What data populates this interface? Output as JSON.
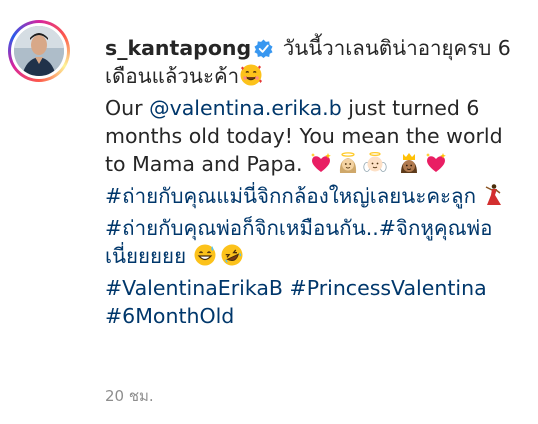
{
  "post": {
    "username": "s_kantapong",
    "caption_thai": "วันนี้วาเลนติน่าอายุครบ 6 เดือนแล้วนะค้า",
    "caption_en_before": "Our ",
    "mention": "@valentina.erika.b",
    "caption_en_after": " just turned 6 months old today! You mean the world to Mama and Papa.",
    "hashtag_1": "#ถ่ายกับคุณแม่นี่จิกกล้องใหญ่เลยนะคะลูก",
    "hashtag_2": "#ถ่ายกับคุณพ่อก็จิกเหมือนกัน..",
    "hashtag_3": "#จิกหูคุณพ่อเนี่ยยยยย",
    "hashtag_4": "#ValentinaErikaB",
    "hashtag_5": "#PrincessValentina",
    "hashtag_6": "#6MonthOld",
    "timestamp": "20 ชม.",
    "icons": [
      "verified-badge-icon",
      "smiling-face-with-hearts-icon",
      "sparkling-heart-icon",
      "woman-with-halo-icon",
      "baby-angel-icon",
      "prince-icon",
      "dancing-woman-icon",
      "grinning-sweat-icon",
      "rolling-laughing-icon"
    ],
    "colors": {
      "text": "#262626",
      "link": "#00376b",
      "verified": "#3897f0",
      "muted": "#8e8e8e"
    }
  }
}
